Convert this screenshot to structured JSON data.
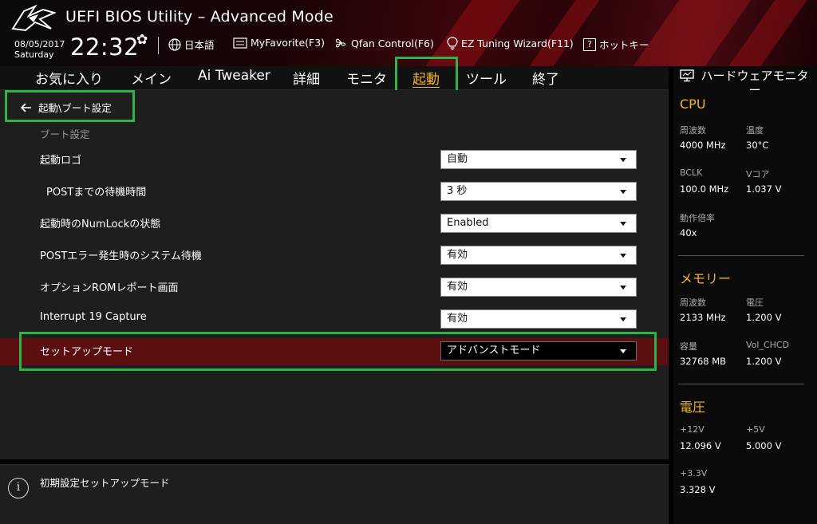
{
  "header": {
    "title": "UEFI BIOS Utility – Advanced Mode",
    "date": "08/05/2017",
    "weekday": "Saturday",
    "time": "22:32",
    "tools": {
      "language": "日本語",
      "myfavorite": "MyFavorite(F3)",
      "qfan": "Qfan Control(F6)",
      "ez_tuning": "EZ Tuning Wizard(F11)",
      "hotkeys": "ホットキー",
      "hotkeys_badge": "?"
    }
  },
  "tabs": [
    {
      "label": "お気に入り"
    },
    {
      "label": "メイン"
    },
    {
      "label": "Ai Tweaker"
    },
    {
      "label": "詳細"
    },
    {
      "label": "モニタ"
    },
    {
      "label": "起動",
      "active": true
    },
    {
      "label": "ツール"
    },
    {
      "label": "終了"
    }
  ],
  "main": {
    "breadcrumb": "起動\\ブート設定",
    "section": "ブート設定",
    "rows": [
      {
        "label": "起動ロゴ",
        "value": "自動"
      },
      {
        "label": "POSTまでの待機時間",
        "value": "3 秒"
      },
      {
        "label": "起動時のNumLockの状態",
        "value": "Enabled"
      },
      {
        "label": "POSTエラー発生時のシステム待機",
        "value": "有効"
      },
      {
        "label": "オプションROMレポート画面",
        "value": "有効"
      },
      {
        "label": "Interrupt 19 Capture",
        "value": "有効"
      },
      {
        "label": "セットアップモード",
        "value": "アドバンストモード",
        "selected": true
      }
    ]
  },
  "help": {
    "icon": "i",
    "text": "初期設定セットアップモード"
  },
  "hwmon": {
    "title": "ハードウェアモニター",
    "cpu": {
      "heading": "CPU",
      "freq_label": "周波数",
      "freq": "4000 MHz",
      "temp_label": "温度",
      "temp": "30°C",
      "bclk_label": "BCLK",
      "bclk": "100.0 MHz",
      "vcore_label": "Vコア",
      "vcore": "1.037 V",
      "ratio_label": "動作倍率",
      "ratio": "40x"
    },
    "memory": {
      "heading": "メモリー",
      "freq_label": "周波数",
      "freq": "2133 MHz",
      "volt_label": "電圧",
      "volt": "1.200 V",
      "cap_label": "容量",
      "cap": "32768 MB",
      "vol_chcd_label": "Vol_CHCD",
      "vol_chcd": "1.200 V"
    },
    "voltage": {
      "heading": "電圧",
      "v12_label": "+12V",
      "v12": "12.096 V",
      "v5_label": "+5V",
      "v5": "5.000 V",
      "v33_label": "+3.3V",
      "v33": "3.328 V"
    }
  },
  "colors": {
    "accent": "#f4b52a",
    "highlight_row": "#5c0f10",
    "annotation_box": "#2fb347"
  }
}
